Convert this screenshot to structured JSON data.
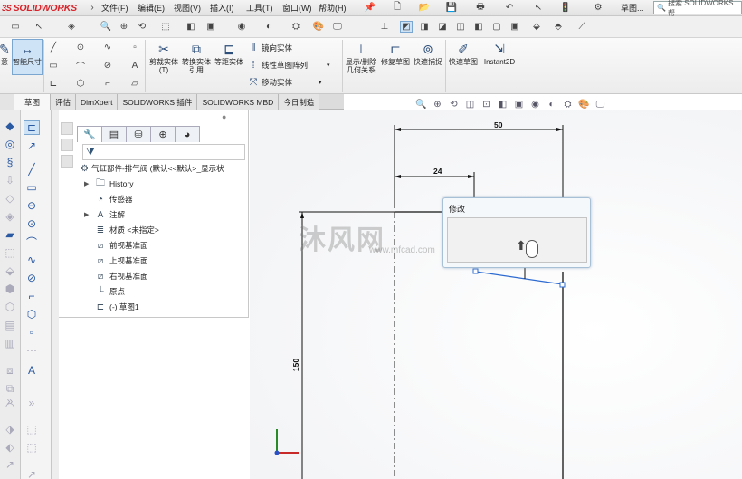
{
  "app": {
    "brand": "SOLIDWORKS",
    "brand_prefix": "3S"
  },
  "menu": {
    "items": [
      "文件(F)",
      "编辑(E)",
      "视图(V)",
      "插入(I)",
      "工具(T)",
      "窗口(W)",
      "帮助(H)"
    ]
  },
  "help_label": "草图...",
  "search": {
    "placeholder": "搜索 SOLIDWORKS 帮"
  },
  "command_manager": {
    "smart_dimension": "智能尺寸",
    "left_cut": "意",
    "convert_cut": "剪裁实体(T)",
    "convert_entities": "转换实体引用",
    "offset_entities": "等距实体",
    "mirror": "镜向实体",
    "linear_pattern": "线性草图阵列",
    "move": "移动实体",
    "display_relations": "显示/删除几何关系",
    "repair_sketch": "修复草图",
    "quick_snaps": "快速捕捉",
    "rapid_sketch": "快速草图",
    "instant2d": "Instant2D"
  },
  "tabs": [
    "",
    "草图",
    "评估",
    "DimXpert",
    "SOLIDWORKS 插件",
    "SOLIDWORKS MBD",
    "今日制造"
  ],
  "feature_tree": {
    "root": "气缸部件-排气阀 (默认<<默认>_显示状",
    "items": [
      {
        "label": "History",
        "icon": "history-folder-icon",
        "expand": true
      },
      {
        "label": "传感器",
        "icon": "sensor-icon",
        "expand": false
      },
      {
        "label": "注解",
        "icon": "annotations-icon",
        "expand": true
      },
      {
        "label": "材质 <未指定>",
        "icon": "material-icon",
        "expand": false
      },
      {
        "label": "前视基准面",
        "icon": "plane-icon",
        "expand": false
      },
      {
        "label": "上视基准面",
        "icon": "plane-icon",
        "expand": false
      },
      {
        "label": "右视基准面",
        "icon": "plane-icon",
        "expand": false
      },
      {
        "label": "原点",
        "icon": "origin-icon",
        "expand": false
      },
      {
        "label": "(-) 草图1",
        "icon": "sketch-icon",
        "expand": false
      }
    ]
  },
  "modify_dialog": {
    "title": "修改"
  },
  "dimensions": {
    "d1": "50",
    "d2": "24",
    "d3": "150"
  },
  "watermark": {
    "text": "沐风网",
    "url": "www.mfcad.com"
  }
}
